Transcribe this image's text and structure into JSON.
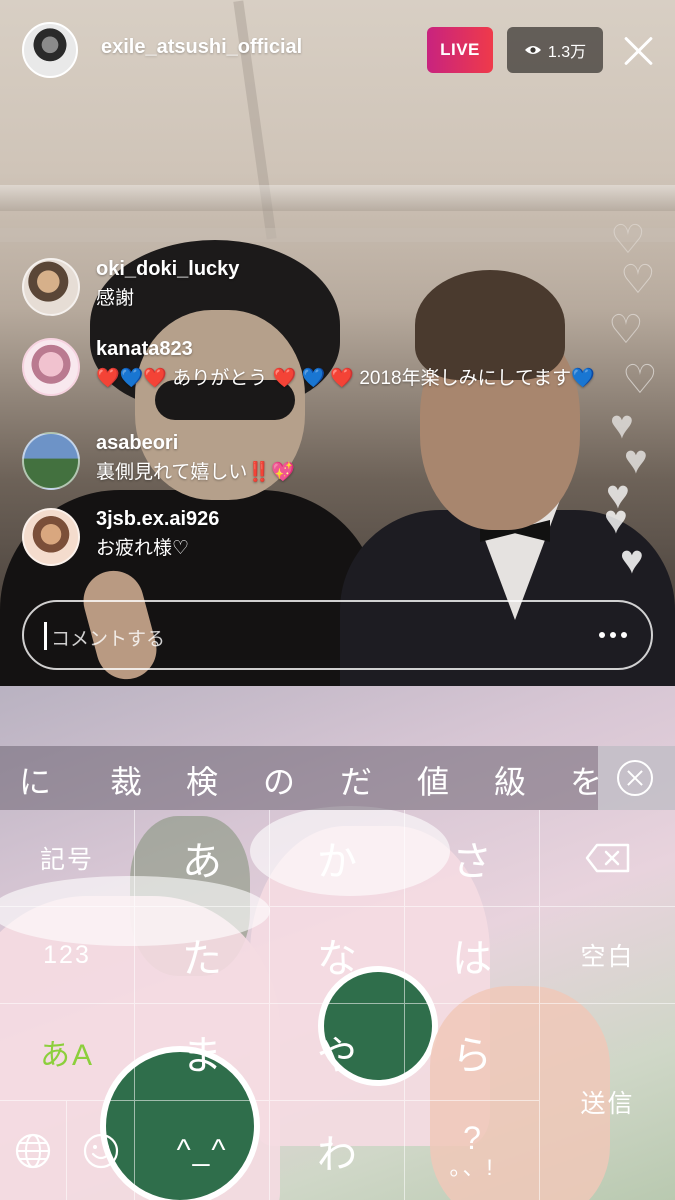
{
  "header": {
    "username": "exile_atsushi_official",
    "live_label": "LIVE",
    "viewer_count": "1.3万"
  },
  "comments": [
    {
      "user": "oki_doki_lucky",
      "text": "感謝"
    },
    {
      "user": "kanata823",
      "text": "❤️💙❤️ ありがとう ❤️ 💙 ❤️ 2018年楽しみにしてます💙"
    },
    {
      "user": "asabeori",
      "text": "裏側見れて嬉しい‼️💖"
    },
    {
      "user": "3jsb.ex.ai926",
      "text": "お疲れ様♡"
    }
  ],
  "comment_input": {
    "placeholder": "コメントする"
  },
  "candidates": [
    "に",
    "裁",
    "検",
    "の",
    "だ",
    "値",
    "級",
    "を"
  ],
  "keys": {
    "symbols": "記号",
    "numbers": "123",
    "mode": "あA",
    "a": "あ",
    "ka": "か",
    "sa": "さ",
    "ta": "た",
    "na": "な",
    "ha": "は",
    "ma": "ま",
    "ya": "や",
    "ra": "ら",
    "kaomoji": "^_^",
    "wa": "わ",
    "punct_top": "?",
    "punct_bottom": "。、!",
    "space": "空白",
    "send": "送信"
  },
  "colors": {
    "live_gradient_start": "#c8237f",
    "live_gradient_end": "#ef3a4a",
    "mode_key_accent": "#8ccf3c"
  }
}
